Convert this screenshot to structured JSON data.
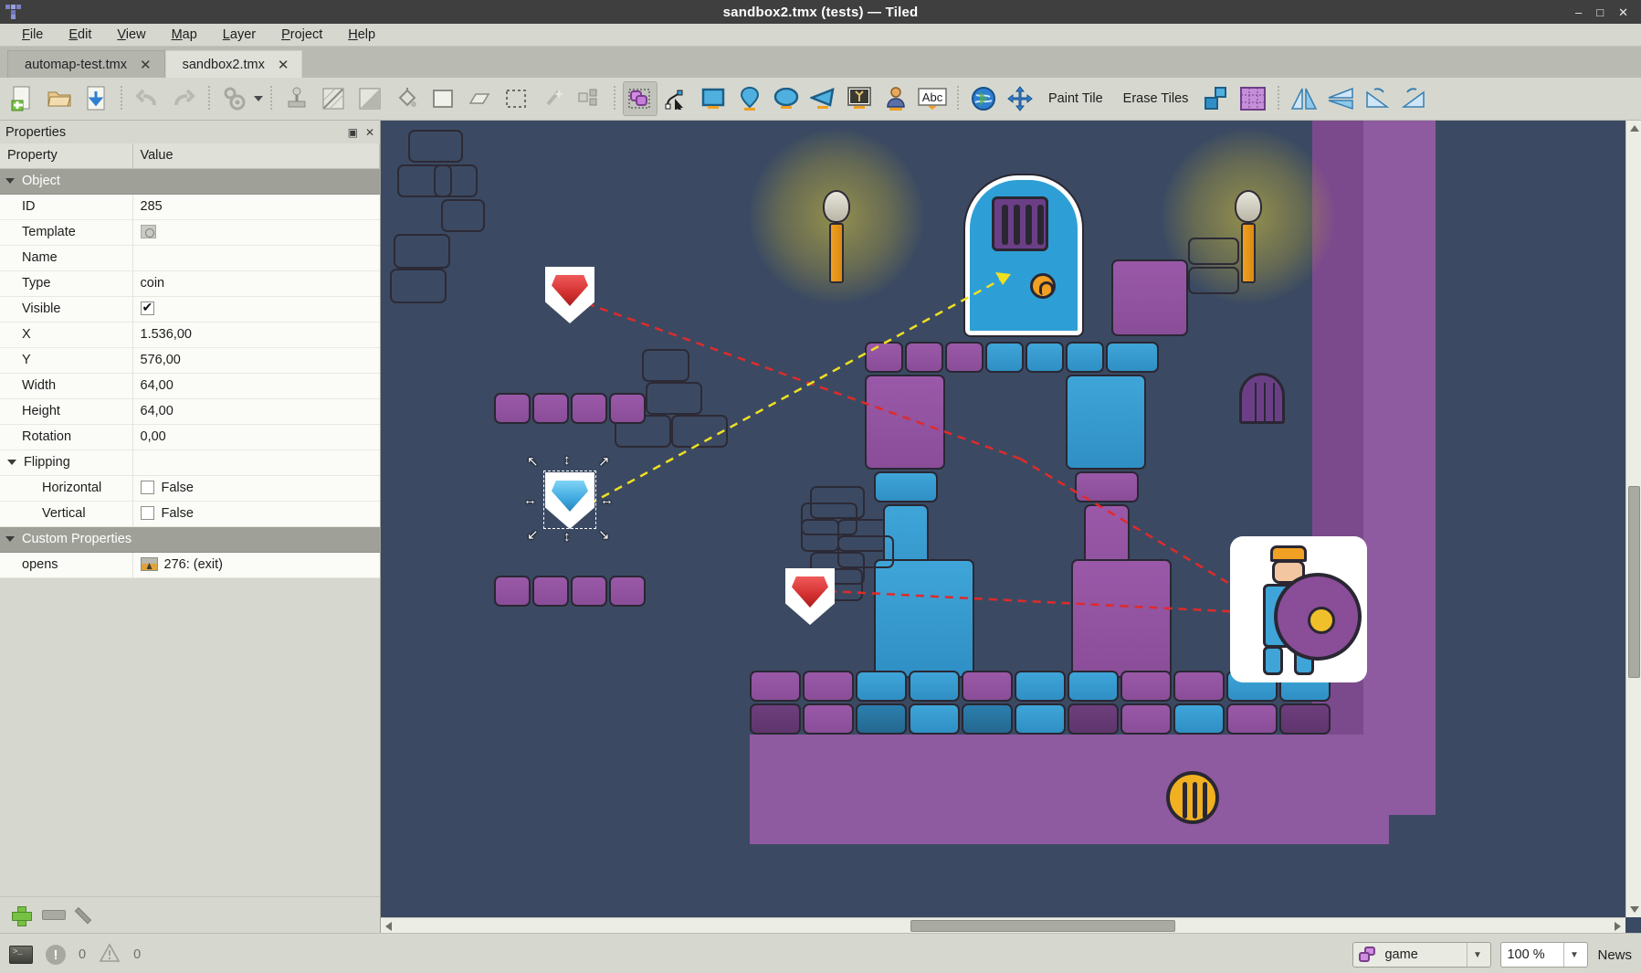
{
  "window": {
    "title": "sandbox2.tmx (tests) — Tiled",
    "app_icon": "tiled-logo-icon",
    "controls": {
      "minimize": "–",
      "maximize": "□",
      "close": "✕"
    }
  },
  "menu": {
    "items": [
      {
        "label": "File",
        "accel": "F"
      },
      {
        "label": "Edit",
        "accel": "E"
      },
      {
        "label": "View",
        "accel": "V"
      },
      {
        "label": "Map",
        "accel": "M"
      },
      {
        "label": "Layer",
        "accel": "L"
      },
      {
        "label": "Project",
        "accel": "P"
      },
      {
        "label": "Help",
        "accel": "H"
      }
    ]
  },
  "tabs": [
    {
      "label": "automap-test.tmx",
      "close": "✕",
      "active": false
    },
    {
      "label": "sandbox2.tmx",
      "close": "✕",
      "active": true
    }
  ],
  "toolbar": {
    "buttons": [
      {
        "name": "new-map-button",
        "icon": "new-file-icon",
        "active": false
      },
      {
        "name": "open-file-button",
        "icon": "open-folder-icon",
        "active": false
      },
      {
        "name": "save-file-button",
        "icon": "save-download-icon",
        "active": false
      },
      {
        "name": "undo-button",
        "icon": "undo-arrow-icon",
        "active": false
      },
      {
        "name": "redo-button",
        "icon": "redo-arrow-icon",
        "active": false
      },
      {
        "name": "automap-button",
        "icon": "gears-icon",
        "active": false
      },
      {
        "name": "stamp-brush-button",
        "icon": "stamp-icon",
        "active": false
      },
      {
        "name": "terrain-brush-button",
        "icon": "terrain-brush-icon",
        "active": false
      },
      {
        "name": "shape-fill-button",
        "icon": "shape-fill-icon",
        "active": false
      },
      {
        "name": "bucket-fill-button",
        "icon": "paint-bucket-icon",
        "active": false
      },
      {
        "name": "rectangle-tool-button",
        "icon": "rectangle-icon",
        "active": false
      },
      {
        "name": "eraser-button",
        "icon": "eraser-icon",
        "active": false
      },
      {
        "name": "rect-select-button",
        "icon": "marquee-select-icon",
        "active": false
      },
      {
        "name": "magic-wand-button",
        "icon": "magic-wand-icon",
        "active": false
      },
      {
        "name": "select-same-tile-button",
        "icon": "select-same-icon",
        "active": false
      },
      {
        "name": "select-objects-button",
        "icon": "object-select-icon",
        "active": true
      },
      {
        "name": "edit-polygons-button",
        "icon": "edit-polygon-icon",
        "active": false
      },
      {
        "name": "insert-rectangle-button",
        "icon": "insert-rect-icon",
        "active": false
      },
      {
        "name": "insert-point-button",
        "icon": "insert-point-icon",
        "active": false
      },
      {
        "name": "insert-ellipse-button",
        "icon": "insert-ellipse-icon",
        "active": false
      },
      {
        "name": "insert-polygon-button",
        "icon": "insert-polygon-icon",
        "active": false
      },
      {
        "name": "insert-tile-button",
        "icon": "insert-tile-icon",
        "active": false
      },
      {
        "name": "insert-template-button",
        "icon": "insert-template-icon",
        "active": false
      },
      {
        "name": "insert-text-button",
        "icon": "insert-text-icon",
        "active": false
      },
      {
        "name": "world-tool-button",
        "icon": "globe-icon",
        "active": false
      },
      {
        "name": "pan-tool-button",
        "icon": "move-cross-icon",
        "active": false
      }
    ],
    "paint_tile_label": "Paint Tile",
    "erase_tiles_label": "Erase Tiles",
    "layer_button_icon": "layers-icon",
    "tileset_button_icon": "tileset-grid-icon",
    "flip_horizontal_icon": "flip-horizontal-icon",
    "flip_vertical_icon": "flip-vertical-icon",
    "rotate_left_icon": "rotate-left-icon",
    "rotate_right_icon": "rotate-right-icon"
  },
  "properties_dock": {
    "title": "Properties",
    "float_icon": "▣",
    "close_icon": "✕",
    "columns": {
      "property": "Property",
      "value": "Value"
    },
    "groups": [
      {
        "name": "Object",
        "rows": [
          {
            "key": "ID",
            "value": "285",
            "kind": "readonly"
          },
          {
            "key": "Template",
            "value": "",
            "kind": "template"
          },
          {
            "key": "Name",
            "value": "",
            "kind": "text"
          },
          {
            "key": "Type",
            "value": "coin",
            "kind": "text"
          },
          {
            "key": "Visible",
            "value": "",
            "kind": "checkbox",
            "checked": true
          },
          {
            "key": "X",
            "value": "1.536,00",
            "kind": "text"
          },
          {
            "key": "Y",
            "value": "576,00",
            "kind": "text"
          },
          {
            "key": "Width",
            "value": "64,00",
            "kind": "text"
          },
          {
            "key": "Height",
            "value": "64,00",
            "kind": "text"
          },
          {
            "key": "Rotation",
            "value": "0,00",
            "kind": "text"
          }
        ]
      },
      {
        "name": "Flipping",
        "rows": [
          {
            "key": "Horizontal",
            "value": "False",
            "kind": "checkbox-label",
            "checked": false
          },
          {
            "key": "Vertical",
            "value": "False",
            "kind": "checkbox-label",
            "checked": false
          }
        ]
      },
      {
        "name": "Custom Properties",
        "rows": [
          {
            "key": "opens",
            "value": "276: (exit)",
            "kind": "tile-ref"
          }
        ]
      }
    ],
    "footer": {
      "add": "add-property-button",
      "remove": "remove-property-button",
      "edit": "edit-property-button"
    }
  },
  "statusbar": {
    "console_icon": "console-icon",
    "error_icon": "error-icon",
    "error_count": "0",
    "warning_icon": "warning-icon",
    "warning_count": "0",
    "layer_selector": {
      "icon": "objects-layer-icon",
      "value": "game",
      "arrow": "▼"
    },
    "zoom": {
      "value": "100 %",
      "arrow": "▼"
    },
    "news_label": "News"
  },
  "canvas": {
    "background_color": "#3b4a62",
    "selected_object": {
      "type": "coin",
      "id": "285",
      "x": "1.536,00",
      "y": "576,00"
    },
    "connector_colors": {
      "exit_link": "#e02a2a",
      "open_link": "#f0e020"
    }
  }
}
